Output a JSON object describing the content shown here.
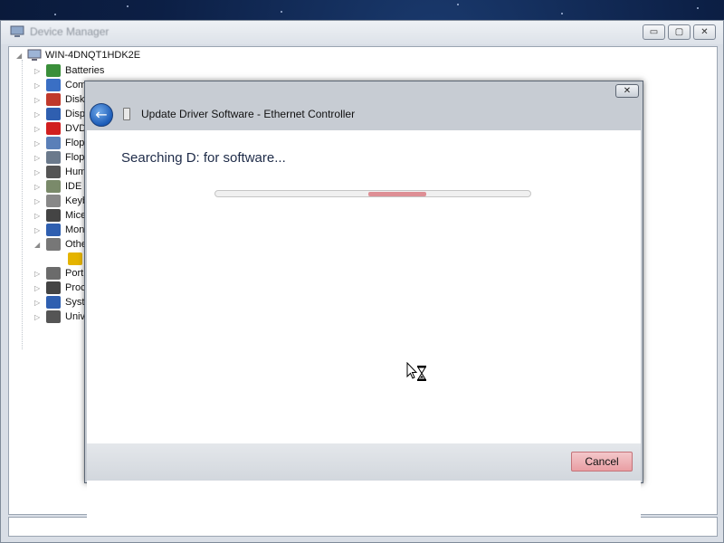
{
  "main_window": {
    "title": "Device Manager",
    "tree": {
      "root": "WIN-4DNQT1HDK2E",
      "items": [
        {
          "label": "Batteries",
          "icon": "battery-icon",
          "color": "#3a8f3a"
        },
        {
          "label": "Compt",
          "icon": "computer-icon",
          "color": "#3a6fc4"
        },
        {
          "label": "Disk",
          "icon": "disk-icon",
          "color": "#c0392b"
        },
        {
          "label": "Disp",
          "icon": "display-icon",
          "color": "#2f5fb0"
        },
        {
          "label": "DVD",
          "icon": "dvd-icon",
          "color": "#d11f1f"
        },
        {
          "label": "Flop",
          "icon": "floppy-icon",
          "color": "#5a7fb8"
        },
        {
          "label": "Flop",
          "icon": "floppy-drive-icon",
          "color": "#6b7a8c"
        },
        {
          "label": "Hum",
          "icon": "hid-icon",
          "color": "#555555"
        },
        {
          "label": "IDE",
          "icon": "ide-icon",
          "color": "#7a8a6a"
        },
        {
          "label": "Keyb",
          "icon": "keyboard-icon",
          "color": "#888888"
        },
        {
          "label": "Mice",
          "icon": "mouse-icon",
          "color": "#444444"
        },
        {
          "label": "Mon",
          "icon": "monitor-icon",
          "color": "#2f5fb0"
        },
        {
          "label": "Othe",
          "icon": "other-devices-icon",
          "color": "#777777"
        },
        {
          "label": "",
          "icon": "warning-device-icon",
          "color": "#e5b400"
        },
        {
          "label": "Port",
          "icon": "port-icon",
          "color": "#6b6b6b"
        },
        {
          "label": "Proc",
          "icon": "processor-icon",
          "color": "#444444"
        },
        {
          "label": "Syst",
          "icon": "system-icon",
          "color": "#2f5fb0"
        },
        {
          "label": "Univ",
          "icon": "usb-icon",
          "color": "#555555"
        }
      ]
    },
    "buttons": {
      "minimize": "▭",
      "maximize": "▢",
      "close": "✕"
    }
  },
  "dialog": {
    "title": "Update Driver Software - Ethernet Controller",
    "status_text": "Searching D: for software...",
    "progress": {
      "state": "indeterminate",
      "color": "#de8f95"
    },
    "cancel_label": "Cancel",
    "close_label": "✕",
    "back_label": "←"
  }
}
